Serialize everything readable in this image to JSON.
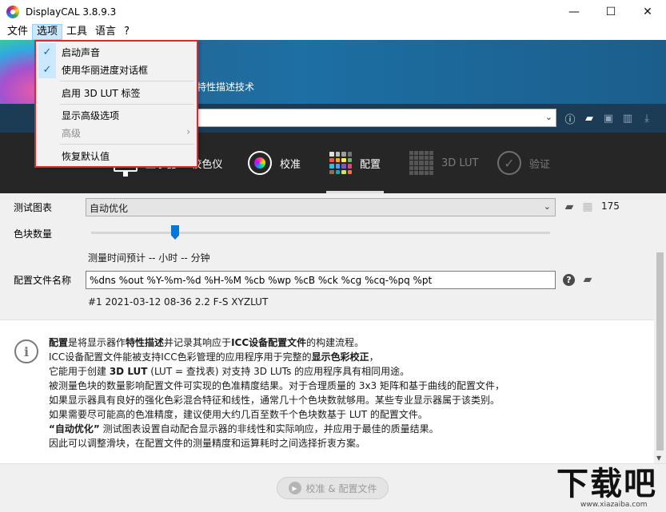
{
  "window": {
    "title": "DisplayCAL 3.8.9.3",
    "minimize": "—",
    "maximize": "☐",
    "close": "✕"
  },
  "menubar": {
    "items": [
      "文件",
      "选项",
      "工具",
      "语言",
      "?"
    ]
  },
  "banner": {
    "text": "特性描述技术"
  },
  "tabs": [
    {
      "label": "显示器 & 校色仪",
      "icon": "monitor-icon"
    },
    {
      "label": "校准",
      "icon": "calibration-icon"
    },
    {
      "label": "配置",
      "icon": "profiling-grid-icon"
    },
    {
      "label": "3D LUT",
      "icon": "lut-grid-icon"
    },
    {
      "label": "验证",
      "icon": "verify-check-icon"
    }
  ],
  "settings": {
    "test_chart_label": "测试图表",
    "test_chart_value": "自动优化",
    "patch_count_label": "色块数量",
    "patch_count_value": "175",
    "patch_count_fraction": 0.18,
    "time_estimate": "测量时间预计 -- 小时 -- 分钟",
    "profile_name_label": "配置文件名称",
    "profile_name_value": "%dns %out %Y-%m-%d %H-%M %cb %wp %cB %ck %cg %cq-%pq %pt",
    "profile_name_example": "#1 2021-03-12 08-36 2.2 F-S XYZLUT"
  },
  "info": {
    "l1_a": "配置",
    "l1_b": "是将显示器作",
    "l1_c": "特性描述",
    "l1_d": "并记录其响应于",
    "l1_e": "ICC设备配置文件",
    "l1_f": "的构建流程。",
    "l2_a": "ICC设备配置文件能被支持ICC色彩管理的应用程序用于完整的",
    "l2_b": "显示色彩校正",
    "l2_c": "，",
    "l3_a": "它能用于创建 ",
    "l3_b": "3D LUT",
    "l3_c": " (LUT = 查找表) 对支持 3D LUTs 的应用程序具有相同用途。",
    "l4": "被测量色块的数量影响配置文件可实现的色准精度结果。对于合理质量的 3x3 矩阵和基于曲线的配置文件，",
    "l5": "如果显示器具有良好的强化色彩混合特征和线性，通常几十个色块数就够用。某些专业显示器属于该类别。",
    "l6": "如果需要尽可能高的色准精度，建议使用大约几百至数千个色块数基于 LUT 的配置文件。",
    "l7_a": "“自动优化”",
    "l7_b": " 测试图表设置自动配合显示器的非线性和实际响应，并应用于最佳的质量结果。",
    "l8": "因此可以调整滑块，在配置文件的测量精度和运算耗时之间选择折衷方案。"
  },
  "bottom": {
    "action_label": "校准 & 配置文件"
  },
  "watermark": {
    "big": "下载吧",
    "url": "www.xiazaiba.com"
  },
  "options_menu": {
    "items": [
      {
        "label": "启动声音",
        "checked": true
      },
      {
        "label": "使用华丽进度对话框",
        "checked": true
      },
      {
        "label": "启用 3D LUT 标签",
        "checked": false
      },
      {
        "label": "显示高级选项",
        "checked": false
      },
      {
        "label": "高级",
        "disabled": true,
        "submenu_arrow": "›"
      },
      {
        "label": "恢复默认值",
        "checked": false
      }
    ],
    "check_glyph": "✓"
  },
  "colors": {
    "accent": "#0078d7",
    "highlight_border": "#d62c2c",
    "tab_bar": "#262626"
  }
}
